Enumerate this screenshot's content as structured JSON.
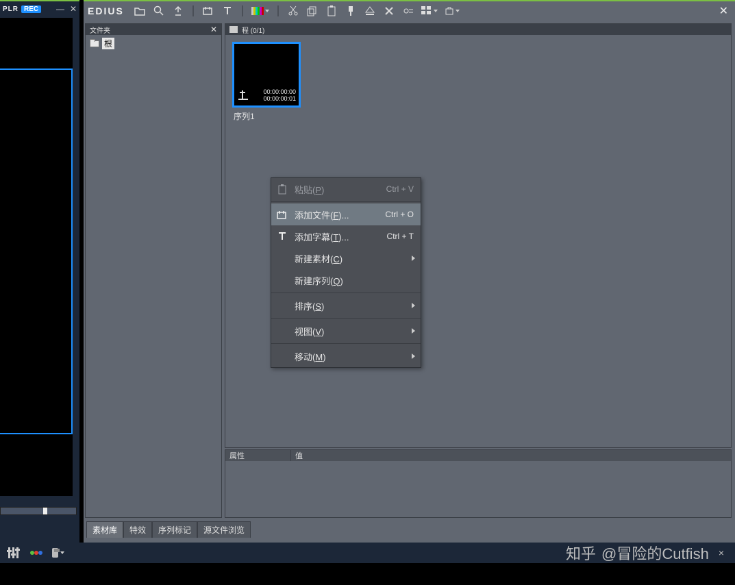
{
  "monitor": {
    "label_plr": "PLR",
    "label_rec": "REC",
    "minimize": "—",
    "close": "✕"
  },
  "toolbar": {
    "title": "EDIUS",
    "close": "✕"
  },
  "folder_panel": {
    "title": "文件夹",
    "close": "✕",
    "root_label": "根"
  },
  "bin_panel": {
    "title": "程 (0/1)",
    "clip": {
      "name": "序列1",
      "tc_in": "00:00:00:00",
      "tc_out": "00:00:00:01"
    }
  },
  "props_panel": {
    "col_attr": "属性",
    "col_val": "值"
  },
  "tabs": {
    "bin": "素材库",
    "effect": "特效",
    "marker": "序列标记",
    "browser": "源文件浏览"
  },
  "ctx": {
    "paste": {
      "label_pre": "粘贴(",
      "key": "P",
      "label_post": ")",
      "shortcut": "Ctrl + V"
    },
    "add_file": {
      "label_pre": "添加文件(",
      "key": "F",
      "label_post": ")...",
      "shortcut": "Ctrl + O"
    },
    "add_title": {
      "label_pre": "添加字幕(",
      "key": "T",
      "label_post": ")...",
      "shortcut": "Ctrl + T"
    },
    "new_clip": {
      "label_pre": "新建素材(",
      "key": "C",
      "label_post": ")"
    },
    "new_seq": {
      "label_pre": "新建序列(",
      "key": "Q",
      "label_post": ")"
    },
    "sort": {
      "label_pre": "排序(",
      "key": "S",
      "label_post": ")"
    },
    "view": {
      "label_pre": "视图(",
      "key": "V",
      "label_post": ")"
    },
    "move": {
      "label_pre": "移动(",
      "key": "M",
      "label_post": ")"
    }
  },
  "watermark": {
    "brand": "知乎",
    "at": "@冒险的Cutfish",
    "close": "×"
  }
}
